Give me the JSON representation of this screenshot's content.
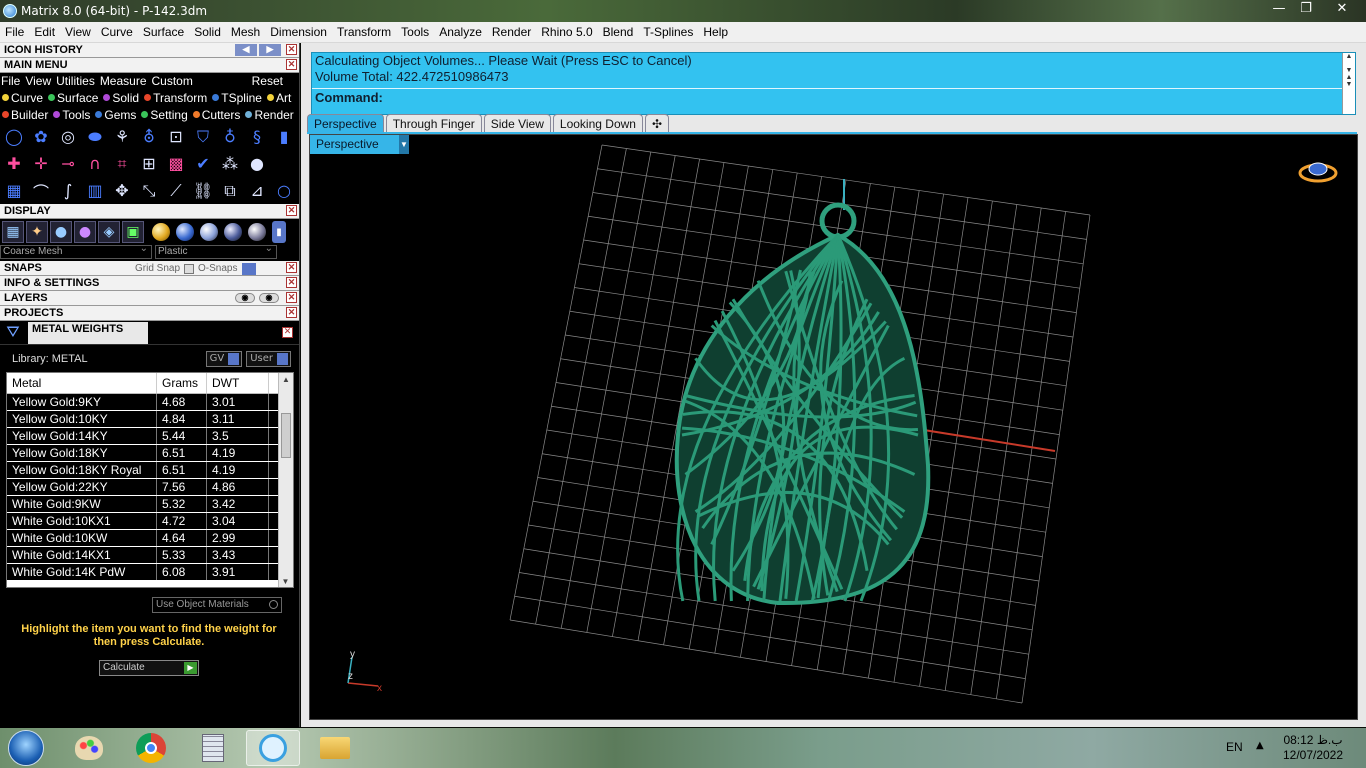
{
  "window": {
    "title": "Matrix 8.0 (64-bit) - P-142.3dm",
    "min": "—",
    "max": "❐",
    "close": "✕"
  },
  "menubar": [
    "File",
    "Edit",
    "View",
    "Curve",
    "Surface",
    "Solid",
    "Mesh",
    "Dimension",
    "Transform",
    "Tools",
    "Analyze",
    "Render",
    "Rhino 5.0",
    "Blend",
    "T-Splines",
    "Help"
  ],
  "left": {
    "icon_history": "ICON HISTORY",
    "main_menu": "MAIN MENU",
    "mm_items": [
      "File",
      "View",
      "Utilities",
      "Measure",
      "Custom"
    ],
    "reset": "Reset",
    "tabs1": [
      {
        "label": "Curve",
        "color": "#f2d23a"
      },
      {
        "label": "Surface",
        "color": "#3ac45a"
      },
      {
        "label": "Solid",
        "color": "#b04ad8"
      },
      {
        "label": "Transform",
        "color": "#e8462a"
      },
      {
        "label": "TSpline",
        "color": "#3a7ad8"
      },
      {
        "label": "Art",
        "color": "#f2d23a"
      }
    ],
    "tabs2": [
      {
        "label": "Builder",
        "color": "#e8462a"
      },
      {
        "label": "Tools",
        "color": "#b04ad8"
      },
      {
        "label": "Gems",
        "color": "#3a7ad8"
      },
      {
        "label": "Setting",
        "color": "#3ac45a"
      },
      {
        "label": "Cutters",
        "color": "#f07a2a"
      },
      {
        "label": "Render",
        "color": "#6fb0d8"
      }
    ],
    "display": "DISPLAY",
    "display_mesh": "Coarse Mesh",
    "display_material": "Plastic",
    "snaps": "SNAPS",
    "grid_snap": "Grid Snap",
    "osnaps": "O-Snaps",
    "info": "INFO & SETTINGS",
    "layers": "LAYERS",
    "projects": "PROJECTS",
    "metal_weights": "METAL WEIGHTS",
    "library": "Library: METAL",
    "gv": "GV",
    "user": "User",
    "table": {
      "headers": [
        "Metal",
        "Grams",
        "DWT"
      ],
      "rows": [
        [
          "Yellow Gold:9KY",
          "4.68",
          "3.01"
        ],
        [
          "Yellow Gold:10KY",
          "4.84",
          "3.11"
        ],
        [
          "Yellow Gold:14KY",
          "5.44",
          "3.5"
        ],
        [
          "Yellow Gold:18KY",
          "6.51",
          "4.19"
        ],
        [
          "Yellow Gold:18KY Royal",
          "6.51",
          "4.19"
        ],
        [
          "Yellow Gold:22KY",
          "7.56",
          "4.86"
        ],
        [
          "White Gold:9KW",
          "5.32",
          "3.42"
        ],
        [
          "White Gold:10KX1",
          "4.72",
          "3.04"
        ],
        [
          "White Gold:10KW",
          "4.64",
          "2.99"
        ],
        [
          "White Gold:14KX1",
          "5.33",
          "3.43"
        ],
        [
          "White Gold:14K PdW",
          "6.08",
          "3.91"
        ]
      ]
    },
    "use_object_materials": "Use Object Materials",
    "hint": "Highlight the item you want to find the weight for then press Calculate.",
    "calculate": "Calculate"
  },
  "command": {
    "line1": "Calculating Object Volumes... Please Wait (Press ESC to Cancel)",
    "line2": "Volume Total: 422.472510986473",
    "prompt": "Command:"
  },
  "viewport_tabs": [
    "Perspective",
    "Through Finger",
    "Side View",
    "Looking Down"
  ],
  "viewport_tab_add": "✣",
  "viewport_label": "Perspective",
  "axis": {
    "y": "y",
    "z": "z",
    "x": "x"
  },
  "taskbar": {
    "lang": "EN",
    "time": "08:12 ب.ظ",
    "date": "12/07/2022"
  }
}
